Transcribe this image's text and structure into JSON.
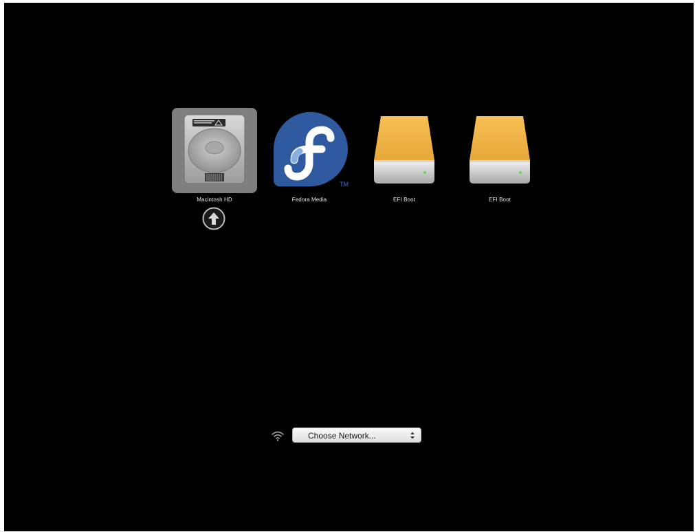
{
  "boot_picker": {
    "disks": [
      {
        "label": "Macintosh HD",
        "icon": "internal-hard-drive-icon",
        "selected": true
      },
      {
        "label": "Fedora Media",
        "icon": "fedora-logo-icon",
        "selected": false
      },
      {
        "label": "EFI Boot",
        "icon": "external-drive-icon",
        "selected": false
      },
      {
        "label": "EFI Boot",
        "icon": "external-drive-icon",
        "selected": false
      }
    ],
    "boot_button_icon": "up-arrow-circle-icon"
  },
  "network": {
    "icon": "wifi-icon",
    "select_value": "Choose Network..."
  },
  "colors": {
    "background": "#000000",
    "selection": "#7f7f7f",
    "drive_orange": "#f0b343",
    "fedora_blue": "#3c6eb4"
  }
}
